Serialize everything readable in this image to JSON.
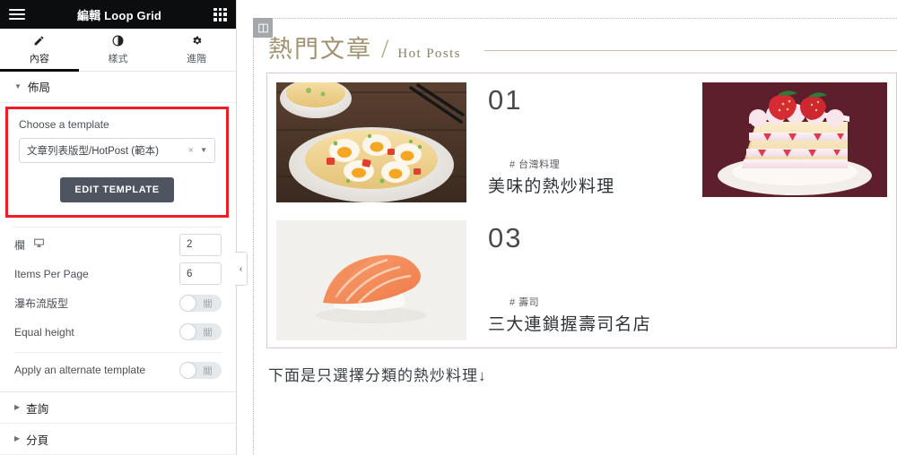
{
  "panel": {
    "header": {
      "menu_icon": "hamburger-icon",
      "title": "編輯 Loop Grid",
      "apps_icon": "grid-apps-icon"
    },
    "tabs": [
      {
        "label": "內容",
        "icon": "pencil-icon",
        "active": true
      },
      {
        "label": "樣式",
        "icon": "half-circle-icon",
        "active": false
      },
      {
        "label": "進階",
        "icon": "gear-icon",
        "active": false
      }
    ],
    "sections": [
      {
        "label": "佈局",
        "expanded": true
      },
      {
        "label": "查詢",
        "expanded": false
      },
      {
        "label": "分頁",
        "expanded": false
      }
    ],
    "template_group": {
      "highlight_color": "#ee1c24",
      "choose_label": "Choose a template",
      "selected_template": "文章列表版型/HotPost (範本)",
      "clear_icon": "×",
      "dropdown_icon": "▼",
      "edit_button": "EDIT TEMPLATE"
    },
    "controls": [
      {
        "label": "欄",
        "icon": "desktop-icon",
        "type": "number",
        "value": "2"
      },
      {
        "label": "Items Per Page",
        "icon": "",
        "type": "number",
        "value": "6"
      },
      {
        "label": "瀑布流版型",
        "icon": "",
        "type": "switch",
        "value": "關"
      },
      {
        "label": "Equal height",
        "icon": "",
        "type": "switch",
        "value": "關"
      },
      {
        "label": "Apply an alternate template",
        "icon": "",
        "type": "switch",
        "value": "關"
      }
    ],
    "collapse_handle": "‹"
  },
  "preview": {
    "widget_handle_icon": "columns-layout-icon",
    "heading": {
      "zh": "熱門文章",
      "separator": "/",
      "en": "Hot Posts",
      "rule_color": "#c9c0ab",
      "text_color": "#a2916f"
    },
    "grid_border_color": "#e4c2e0",
    "posts": [
      {
        "number": "01",
        "tag": "# 台灣料理",
        "title": "美味的熱炒料理",
        "thumb": "fried-rice-with-egg-photo"
      },
      {
        "number": "03",
        "tag": "# 壽司",
        "title": "三大連鎖握壽司名店",
        "thumb": "salmon-nigiri-sushi-photo"
      }
    ],
    "side_image": "strawberry-shortcake-photo",
    "footer_note": "下面是只選擇分類的熱炒料理↓"
  }
}
